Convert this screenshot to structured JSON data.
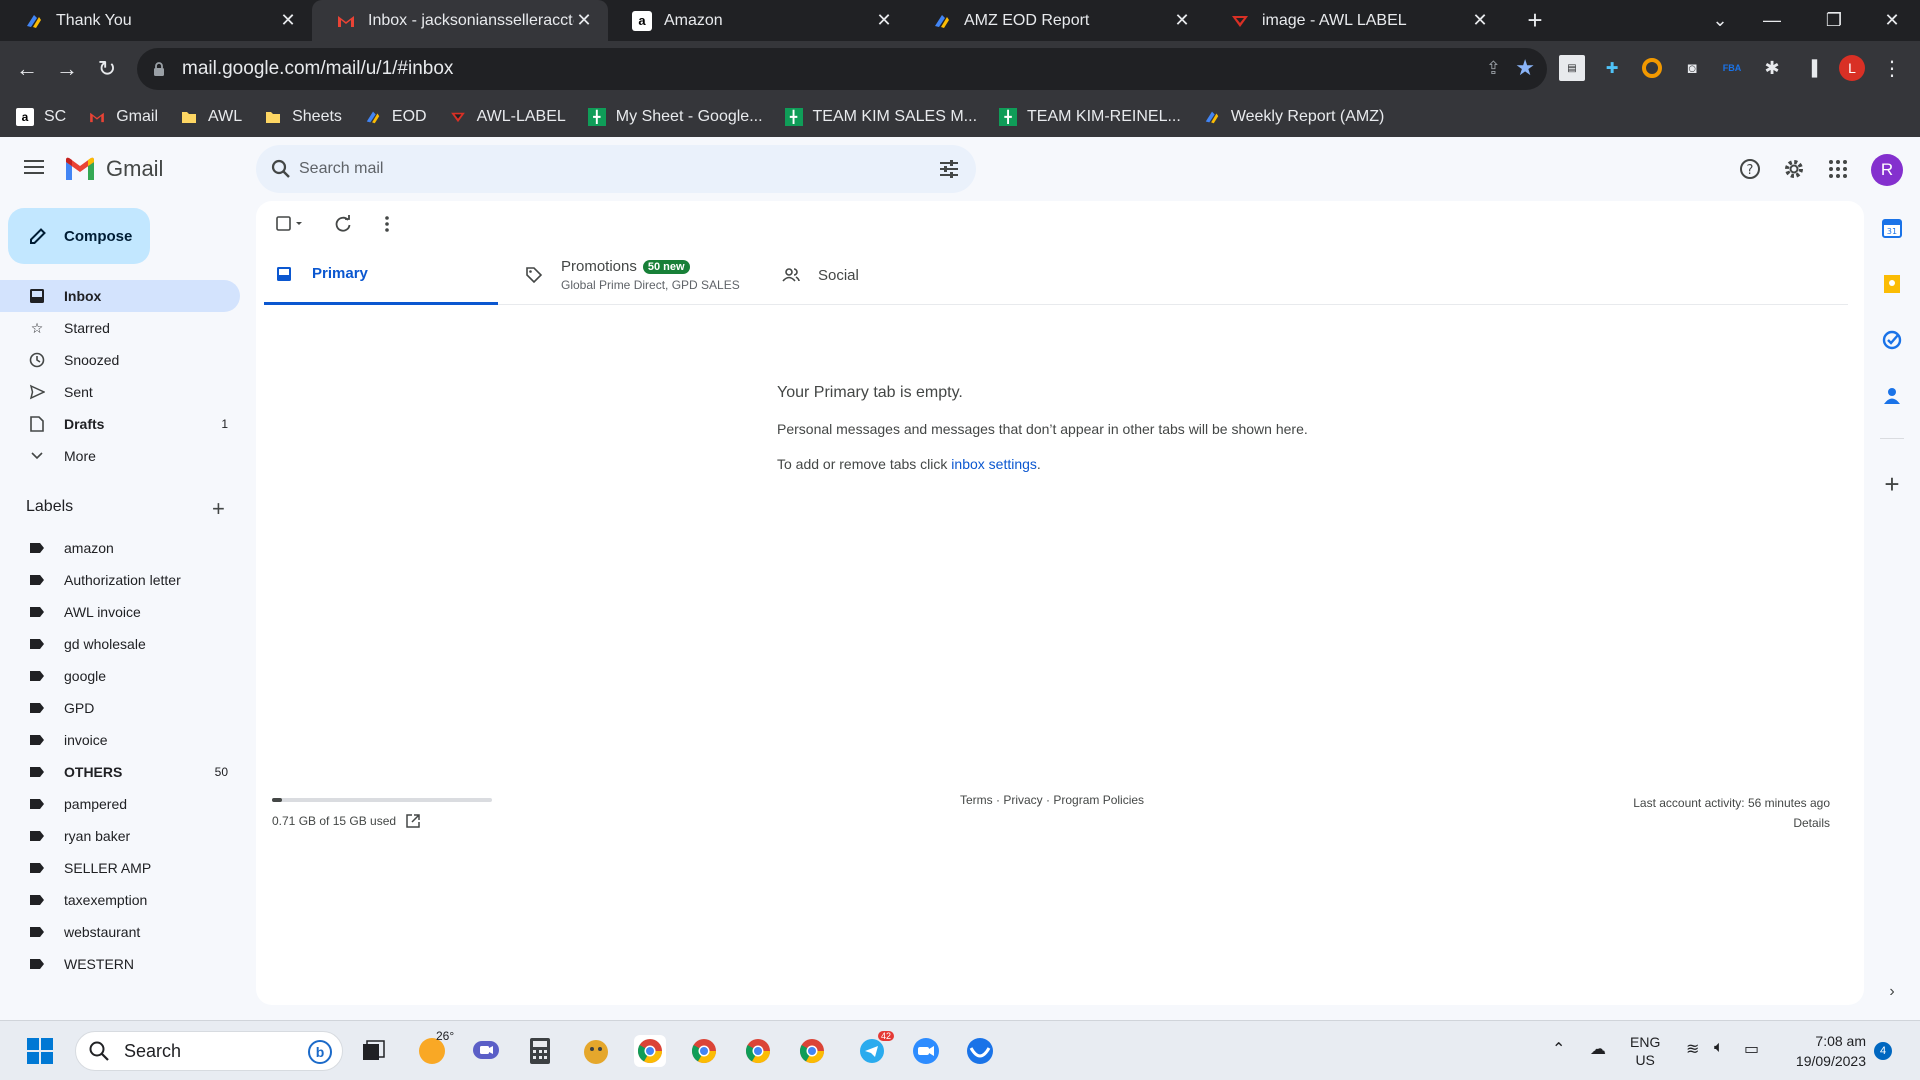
{
  "browser": {
    "tabs": [
      {
        "title": "Thank You",
        "icon": "eod-logo"
      },
      {
        "title": "Inbox - jacksoniansselleracct@gm",
        "icon": "gmail-logo"
      },
      {
        "title": "Amazon",
        "icon": "amazon-logo"
      },
      {
        "title": "AMZ EOD Report",
        "icon": "eod-logo"
      },
      {
        "title": "image - AWL LABEL",
        "icon": "awl-logo"
      }
    ],
    "url": "mail.google.com/mail/u/1/#inbox",
    "profile_initial": "L",
    "bookmarks": [
      {
        "label": "SC",
        "icon": "amazon-logo"
      },
      {
        "label": "Gmail",
        "icon": "gmail-logo"
      },
      {
        "label": "AWL",
        "icon": "folder-icon"
      },
      {
        "label": "Sheets",
        "icon": "folder-icon"
      },
      {
        "label": "EOD",
        "icon": "eod-logo"
      },
      {
        "label": "AWL-LABEL",
        "icon": "awl-logo"
      },
      {
        "label": "My Sheet - Google...",
        "icon": "sheets-icon"
      },
      {
        "label": "TEAM KIM SALES M...",
        "icon": "sheets-icon"
      },
      {
        "label": "TEAM KIM-REINEL...",
        "icon": "sheets-icon"
      },
      {
        "label": "Weekly Report (AMZ)",
        "icon": "eod-logo"
      }
    ]
  },
  "gmail": {
    "brand": "Gmail",
    "search_placeholder": "Search mail",
    "avatar_initial": "R",
    "compose_label": "Compose",
    "nav": [
      {
        "label": "Inbox",
        "icon": "inbox-icon",
        "count": ""
      },
      {
        "label": "Starred",
        "icon": "star-icon",
        "count": ""
      },
      {
        "label": "Snoozed",
        "icon": "clock-icon",
        "count": ""
      },
      {
        "label": "Sent",
        "icon": "send-icon",
        "count": ""
      },
      {
        "label": "Drafts",
        "icon": "draft-icon",
        "count": "1"
      },
      {
        "label": "More",
        "icon": "chevron-down-icon",
        "count": ""
      }
    ],
    "labels_heading": "Labels",
    "labels": [
      {
        "label": "amazon",
        "count": ""
      },
      {
        "label": "Authorization letter",
        "count": ""
      },
      {
        "label": "AWL invoice",
        "count": ""
      },
      {
        "label": "gd wholesale",
        "count": ""
      },
      {
        "label": "google",
        "count": ""
      },
      {
        "label": "GPD",
        "count": ""
      },
      {
        "label": "invoice",
        "count": ""
      },
      {
        "label": "OTHERS",
        "count": "50"
      },
      {
        "label": "pampered",
        "count": ""
      },
      {
        "label": "ryan baker",
        "count": ""
      },
      {
        "label": "SELLER AMP",
        "count": ""
      },
      {
        "label": "taxexemption",
        "count": ""
      },
      {
        "label": "webstaurant",
        "count": ""
      },
      {
        "label": "WESTERN",
        "count": ""
      }
    ],
    "inbox_tabs": {
      "primary": "Primary",
      "promotions": "Promotions",
      "promotions_badge": "50 new",
      "promotions_senders": "Global Prime Direct, GPD SALES",
      "social": "Social"
    },
    "empty": {
      "heading": "Your Primary tab is empty.",
      "body": "Personal messages and messages that don’t appear in other tabs will be shown here.",
      "prefix": "To add or remove tabs click ",
      "link": "inbox settings",
      "suffix": "."
    },
    "storage": {
      "text": "0.71 GB of 15 GB used",
      "fraction": 0.047
    },
    "footer": {
      "terms": "Terms",
      "privacy": "Privacy",
      "policies": "Program Policies",
      "sep": " · "
    },
    "activity": {
      "last": "Last account activity: 56 minutes ago",
      "details": "Details"
    }
  },
  "taskbar": {
    "search_label": "Search",
    "weather": "26°",
    "telegram_badge": "42",
    "lang": "ENG",
    "region": "US",
    "time": "7:08 am",
    "date": "19/09/2023",
    "notifications": "4"
  }
}
